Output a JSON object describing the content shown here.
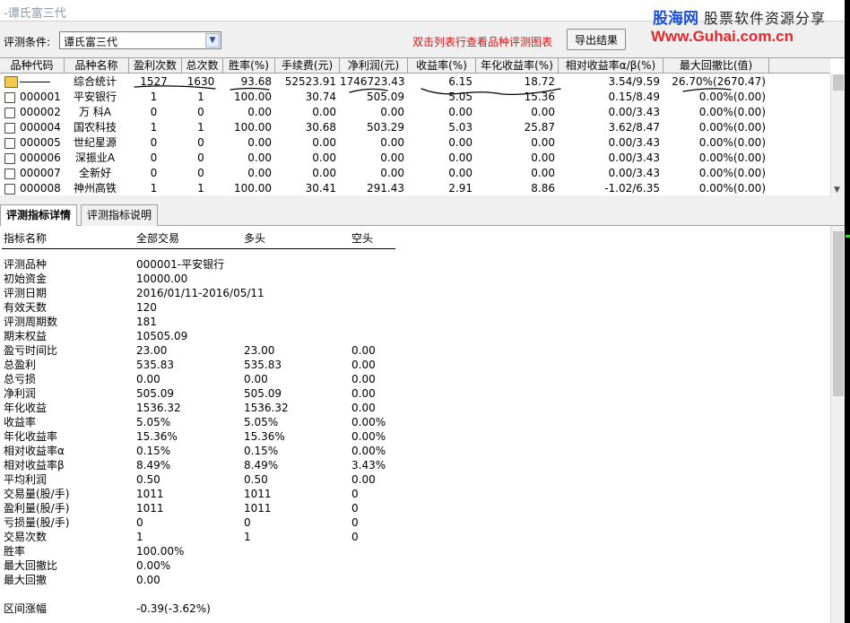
{
  "window": {
    "title": "-谭氏富三代"
  },
  "watermark": {
    "brand": "股海网",
    "slogan": "股票软件资源分享",
    "url": "Www.Guhai.com.cn"
  },
  "toolbar": {
    "condition_label": "评测条件:",
    "condition_value": "谭氏富三代",
    "hint": "双击列表行查看品种评测图表",
    "export_label": "导出结果"
  },
  "table": {
    "headers": [
      "品种代码",
      "品种名称",
      "盈利次数",
      "总次数",
      "胜率(%)",
      "手续费(元)",
      "净利润(元)",
      "收益率(%)",
      "年化收益率(%)",
      "相对收益率α/β(%)",
      "最大回撤比(值)"
    ],
    "rows": [
      {
        "code": "",
        "name": "综合统计",
        "win_count": "1527",
        "total_count": "1630",
        "win_rate": "93.68",
        "fee": "52523.91",
        "net_profit": "1746723.43",
        "return": "6.15",
        "annual_return": "18.72",
        "alpha_beta": "3.54/9.59",
        "max_drawdown": "26.70%(2670.47)"
      },
      {
        "code": "000001",
        "name": "平安银行",
        "win_count": "1",
        "total_count": "1",
        "win_rate": "100.00",
        "fee": "30.74",
        "net_profit": "505.09",
        "return": "5.05",
        "annual_return": "15.36",
        "alpha_beta": "0.15/8.49",
        "max_drawdown": "0.00%(0.00)"
      },
      {
        "code": "000002",
        "name": "万 科A",
        "win_count": "0",
        "total_count": "0",
        "win_rate": "0.00",
        "fee": "0.00",
        "net_profit": "0.00",
        "return": "0.00",
        "annual_return": "0.00",
        "alpha_beta": "0.00/3.43",
        "max_drawdown": "0.00%(0.00)"
      },
      {
        "code": "000004",
        "name": "国农科技",
        "win_count": "1",
        "total_count": "1",
        "win_rate": "100.00",
        "fee": "30.68",
        "net_profit": "503.29",
        "return": "5.03",
        "annual_return": "25.87",
        "alpha_beta": "3.62/8.47",
        "max_drawdown": "0.00%(0.00)"
      },
      {
        "code": "000005",
        "name": "世纪星源",
        "win_count": "0",
        "total_count": "0",
        "win_rate": "0.00",
        "fee": "0.00",
        "net_profit": "0.00",
        "return": "0.00",
        "annual_return": "0.00",
        "alpha_beta": "0.00/3.43",
        "max_drawdown": "0.00%(0.00)"
      },
      {
        "code": "000006",
        "name": "深振业A",
        "win_count": "0",
        "total_count": "0",
        "win_rate": "0.00",
        "fee": "0.00",
        "net_profit": "0.00",
        "return": "0.00",
        "annual_return": "0.00",
        "alpha_beta": "0.00/3.43",
        "max_drawdown": "0.00%(0.00)"
      },
      {
        "code": "000007",
        "name": "全新好",
        "win_count": "0",
        "total_count": "0",
        "win_rate": "0.00",
        "fee": "0.00",
        "net_profit": "0.00",
        "return": "0.00",
        "annual_return": "0.00",
        "alpha_beta": "0.00/3.43",
        "max_drawdown": "0.00%(0.00)"
      },
      {
        "code": "000008",
        "name": "神州高铁",
        "win_count": "1",
        "total_count": "1",
        "win_rate": "100.00",
        "fee": "30.41",
        "net_profit": "291.43",
        "return": "2.91",
        "annual_return": "8.86",
        "alpha_beta": "-1.02/6.35",
        "max_drawdown": "0.00%(0.00)"
      }
    ]
  },
  "tabs": [
    {
      "label": "评测指标详情",
      "active": true
    },
    {
      "label": "评测指标说明",
      "active": false
    }
  ],
  "detail": {
    "headers": [
      "指标名称",
      "全部交易",
      "多头",
      "空头"
    ],
    "rows": [
      [
        "评测品种",
        "000001-平安银行",
        "",
        ""
      ],
      [
        "初始资金",
        "10000.00",
        "",
        ""
      ],
      [
        "评测日期",
        "2016/01/11-2016/05/11",
        "",
        ""
      ],
      [
        "有效天数",
        "120",
        "",
        ""
      ],
      [
        "评测周期数",
        "181",
        "",
        ""
      ],
      [
        "期末权益",
        "10505.09",
        "",
        ""
      ],
      [
        "盈亏时间比",
        "23.00",
        "23.00",
        "0.00"
      ],
      [
        "总盈利",
        "535.83",
        "535.83",
        "0.00"
      ],
      [
        "总亏损",
        "0.00",
        "0.00",
        "0.00"
      ],
      [
        "净利润",
        "505.09",
        "505.09",
        "0.00"
      ],
      [
        "年化收益",
        "1536.32",
        "1536.32",
        "0.00"
      ],
      [
        "收益率",
        "5.05%",
        "5.05%",
        "0.00%"
      ],
      [
        "年化收益率",
        "15.36%",
        "15.36%",
        "0.00%"
      ],
      [
        "相对收益率α",
        "0.15%",
        "0.15%",
        "0.00%"
      ],
      [
        "相对收益率β",
        "8.49%",
        "8.49%",
        "3.43%"
      ],
      [
        "平均利润",
        "0.50",
        "0.50",
        "0.00"
      ],
      [
        "交易量(股/手)",
        "1011",
        "1011",
        "0"
      ],
      [
        "盈利量(股/手)",
        "1011",
        "1011",
        "0"
      ],
      [
        "亏损量(股/手)",
        "0",
        "0",
        "0"
      ],
      [
        "交易次数",
        "1",
        "1",
        "0"
      ],
      [
        "胜率",
        "100.00%",
        "",
        ""
      ],
      [
        "最大回撤比",
        "0.00%",
        "",
        ""
      ],
      [
        "最大回撤",
        "0.00",
        "",
        ""
      ],
      [
        "",
        "",
        "",
        ""
      ],
      [
        "区间涨幅",
        "-0.39(-3.62%)",
        "",
        ""
      ]
    ]
  }
}
